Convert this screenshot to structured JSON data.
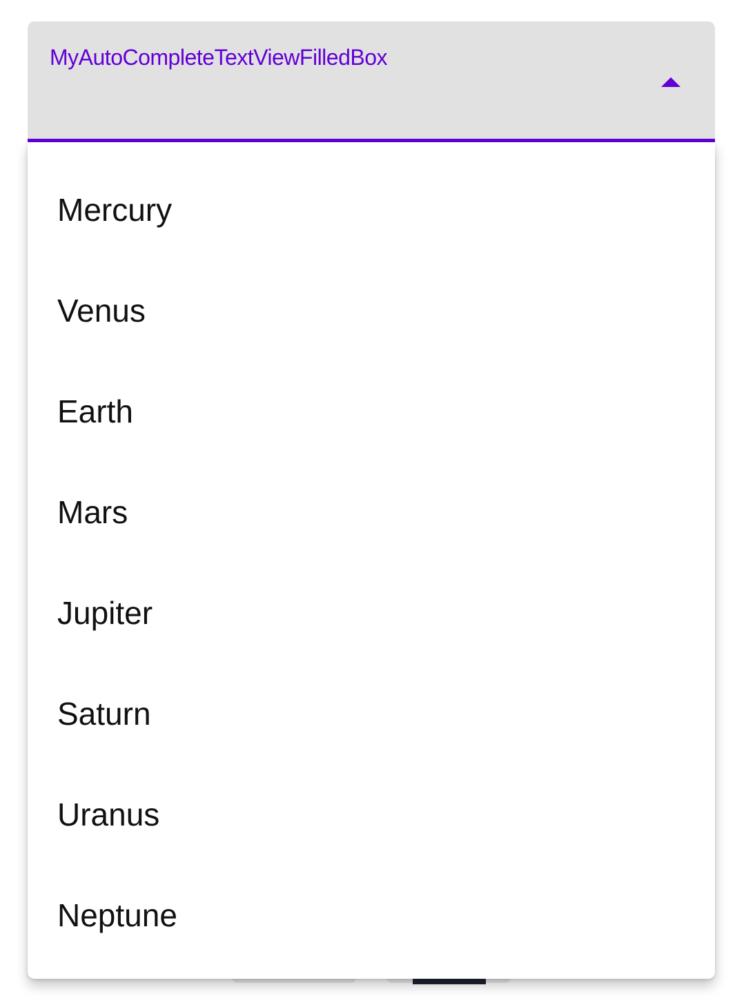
{
  "field": {
    "label": "MyAutoCompleteTextViewFilledBox",
    "toggle_icon": "arrow-drop-up-icon",
    "accent_color": "#6200d6",
    "background_color": "#e1e1e2"
  },
  "dropdown": {
    "options": [
      {
        "label": "Mercury"
      },
      {
        "label": "Venus"
      },
      {
        "label": "Earth"
      },
      {
        "label": "Mars"
      },
      {
        "label": "Jupiter"
      },
      {
        "label": "Saturn"
      },
      {
        "label": "Uranus"
      },
      {
        "label": "Neptune"
      }
    ]
  }
}
